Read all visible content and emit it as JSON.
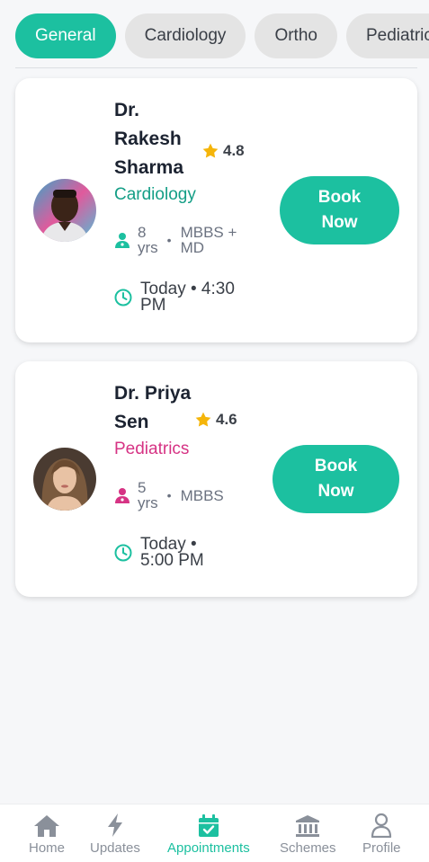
{
  "tabs": [
    "General",
    "Cardiology",
    "Ortho",
    "Pediatrics"
  ],
  "doctors": [
    {
      "name_line1": "Dr.",
      "name_line2": "Rakesh",
      "name_line3": "Sharma",
      "rating": "4.8",
      "specialty": "Cardiology",
      "specialty_color": "#149e86",
      "experience_num": "8",
      "experience_unit": "yrs",
      "degree_line1": "MBBS +",
      "degree_line2": "MD",
      "time_line1": "Today • 4:30",
      "time_line2": "PM",
      "book_label": "Book Now"
    },
    {
      "name_line1": "Dr. Priya",
      "name_line2": "Sen",
      "rating": "4.6",
      "specialty": "Pediatrics",
      "specialty_color": "#d63384",
      "experience_num": "5",
      "experience_unit": "yrs",
      "degree_line1": "MBBS",
      "time_line1": "Today •",
      "time_line2": "5:00 PM",
      "book_label": "Book Now"
    }
  ],
  "nav": [
    {
      "label": "Home",
      "icon": "home-icon"
    },
    {
      "label": "Updates",
      "icon": "lightning-icon"
    },
    {
      "label": "Appointments",
      "icon": "calendar-check-icon",
      "active": true
    },
    {
      "label": "Schemes",
      "icon": "bank-icon"
    },
    {
      "label": "Profile",
      "icon": "user-icon"
    }
  ],
  "colors": {
    "accent": "#1cc0a0",
    "star": "#f5b50a",
    "tab_inactive": "#e4e4e4"
  }
}
